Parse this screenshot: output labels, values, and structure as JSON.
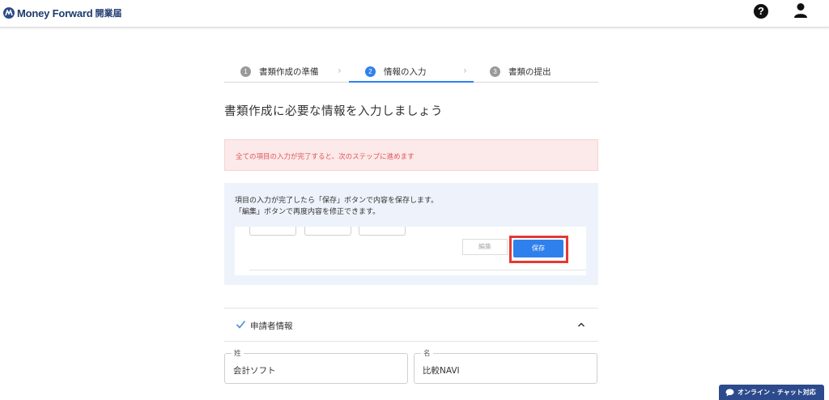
{
  "header": {
    "brand": "Money Forward",
    "product": "開業届",
    "help_icon": "question-circle-icon",
    "user_icon": "user-icon",
    "help_glyph": "?"
  },
  "stepper": {
    "steps": [
      {
        "num": "1",
        "label": "書類作成の準備",
        "active": false
      },
      {
        "num": "2",
        "label": "情報の入力",
        "active": true
      },
      {
        "num": "3",
        "label": "書類の提出",
        "active": false
      }
    ],
    "separator": "›",
    "accent": "#2f80ed"
  },
  "page_title": "書類作成に必要な情報を入力しましょう",
  "alert": {
    "text": "全ての項目の入力が完了すると、次のステップに進めます",
    "color": "#e05656"
  },
  "info": {
    "line1": "項目の入力が完了したら「保存」ボタンで内容を保存します。",
    "line2": "「編集」ボタンで再度内容を修正できます。",
    "edit_label": "編集",
    "save_label": "保存"
  },
  "section": {
    "label": "申請者情報"
  },
  "fields": {
    "last_name": {
      "label": "姓",
      "value": "会計ソフト"
    },
    "first_name": {
      "label": "名",
      "value": "比較NAVI"
    }
  },
  "chat": {
    "label": "オンライン - チャット対応"
  }
}
